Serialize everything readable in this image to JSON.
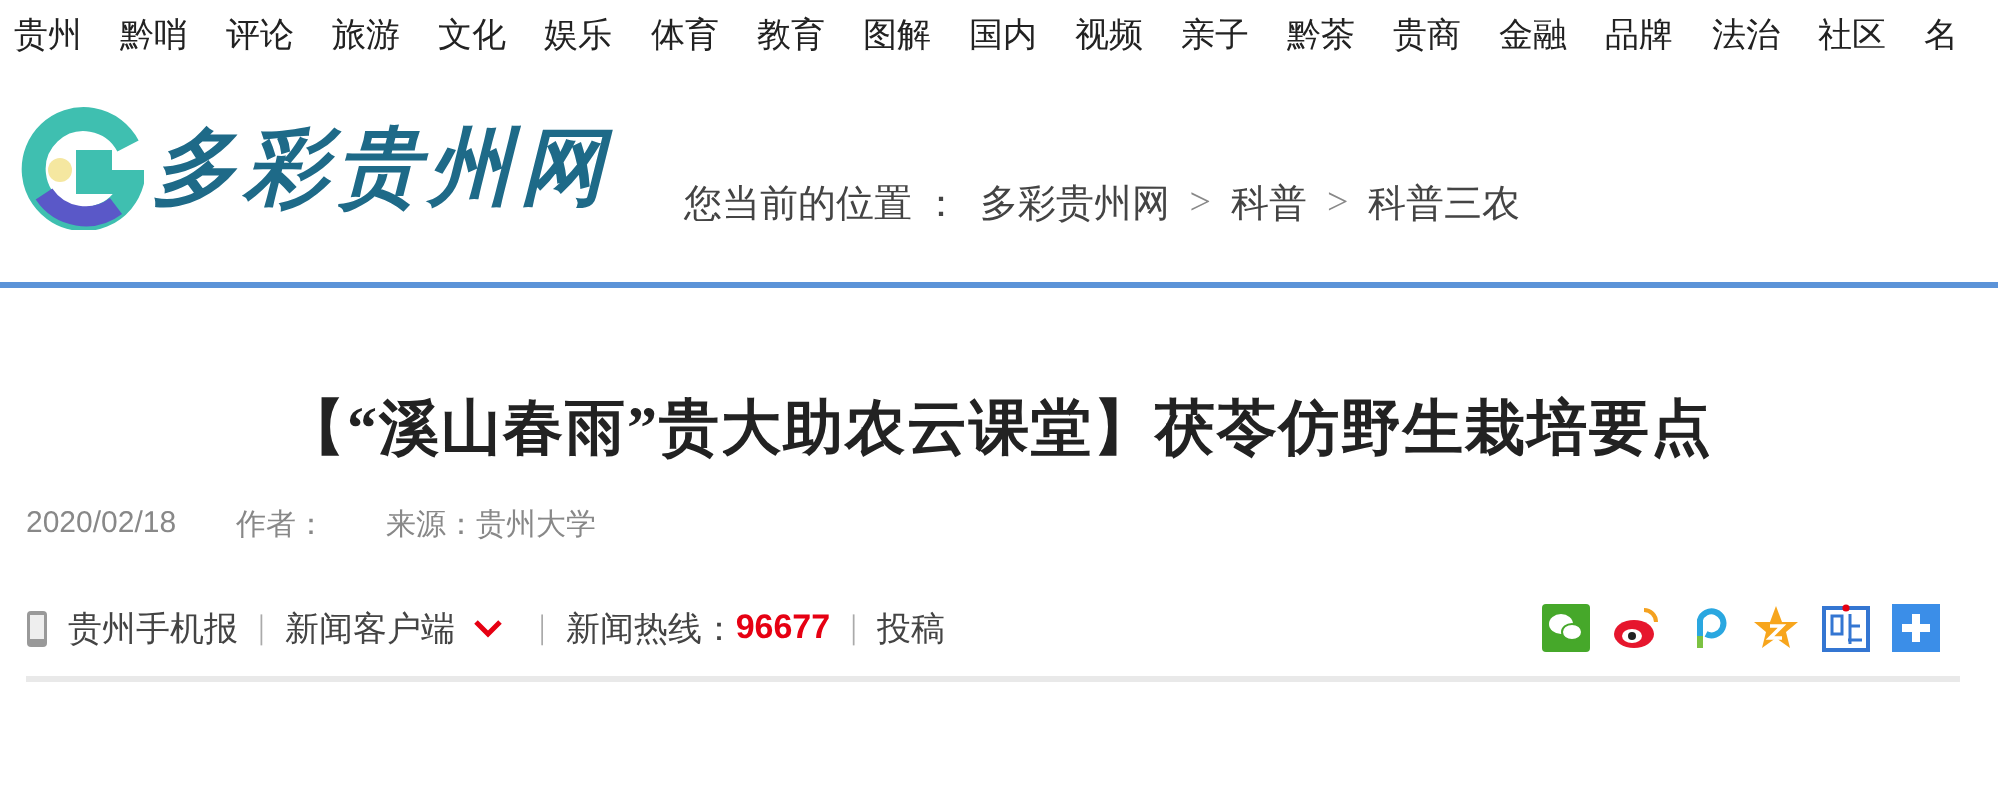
{
  "top_nav": [
    "贵州",
    "黔哨",
    "评论",
    "旅游",
    "文化",
    "娱乐",
    "体育",
    "教育",
    "图解",
    "国内",
    "视频",
    "亲子",
    "黔茶",
    "贵商",
    "金融",
    "品牌",
    "法治",
    "社区",
    "名"
  ],
  "logo": {
    "text": "多彩贵州网"
  },
  "breadcrumb": {
    "label": "您当前的位置 ：",
    "items": [
      "多彩贵州网",
      "科普",
      "科普三农"
    ],
    "separator": ">"
  },
  "article": {
    "title": "【“溪山春雨”贵大助农云课堂】茯苓仿野生栽培要点",
    "date": "2020/02/18",
    "author": "作者：",
    "source": "来源：贵州大学"
  },
  "toolbar": {
    "mobile": "贵州手机报",
    "client": "新闻客户端",
    "hotline_label": "新闻热线：",
    "hotline": "96677",
    "submit": "投稿",
    "separator": "|"
  }
}
